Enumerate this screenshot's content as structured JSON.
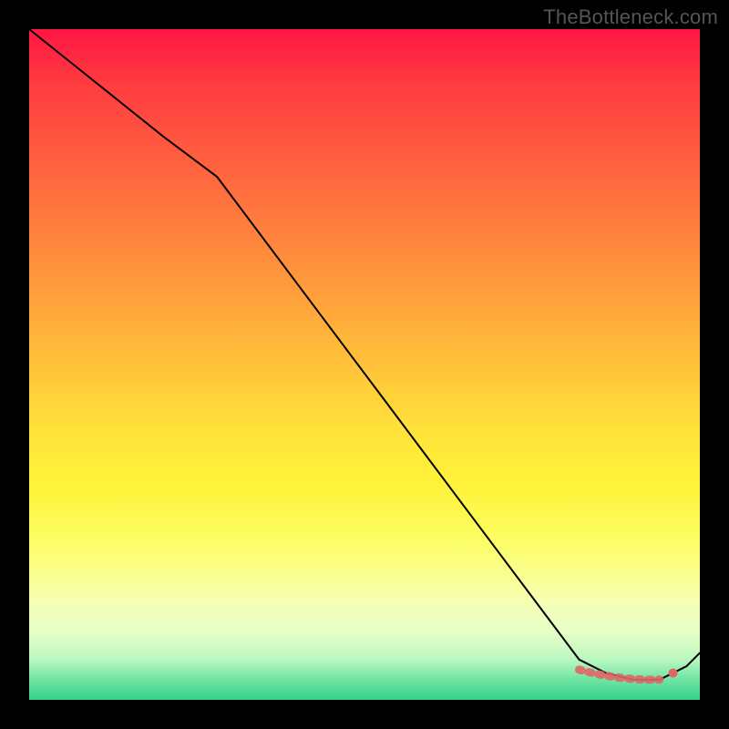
{
  "watermark": "TheBottleneck.com",
  "chart_data": {
    "type": "line",
    "title": "",
    "xlabel": "",
    "ylabel": "",
    "xlim": [
      0,
      100
    ],
    "ylim": [
      0,
      100
    ],
    "grid": false,
    "legend": false,
    "series": [
      {
        "name": "curve",
        "color": "#000000",
        "stroke_width": 2,
        "x": [
          0,
          10,
          20,
          28,
          40,
          52,
          64,
          76,
          82,
          86,
          90,
          94,
          98,
          100
        ],
        "y": [
          100,
          92,
          84,
          78,
          62,
          46,
          30,
          14,
          6,
          4,
          3,
          3,
          5,
          7
        ]
      }
    ],
    "markers": [
      {
        "name": "flat-region",
        "type": "dotted-segment",
        "color": "#e06666",
        "x": [
          82,
          84,
          86,
          88,
          90,
          92,
          94
        ],
        "y": [
          4.5,
          4.0,
          3.6,
          3.3,
          3.1,
          3.0,
          3.0
        ]
      },
      {
        "name": "end-point",
        "type": "dot",
        "color": "#e06666",
        "x": 96,
        "y": 4.0,
        "r": 5
      }
    ],
    "gradient_stops": [
      {
        "pos": 0,
        "color": "#ff1744"
      },
      {
        "pos": 50,
        "color": "#ffe33a"
      },
      {
        "pos": 85,
        "color": "#f7ffb2"
      },
      {
        "pos": 100,
        "color": "#33d38b"
      }
    ]
  }
}
